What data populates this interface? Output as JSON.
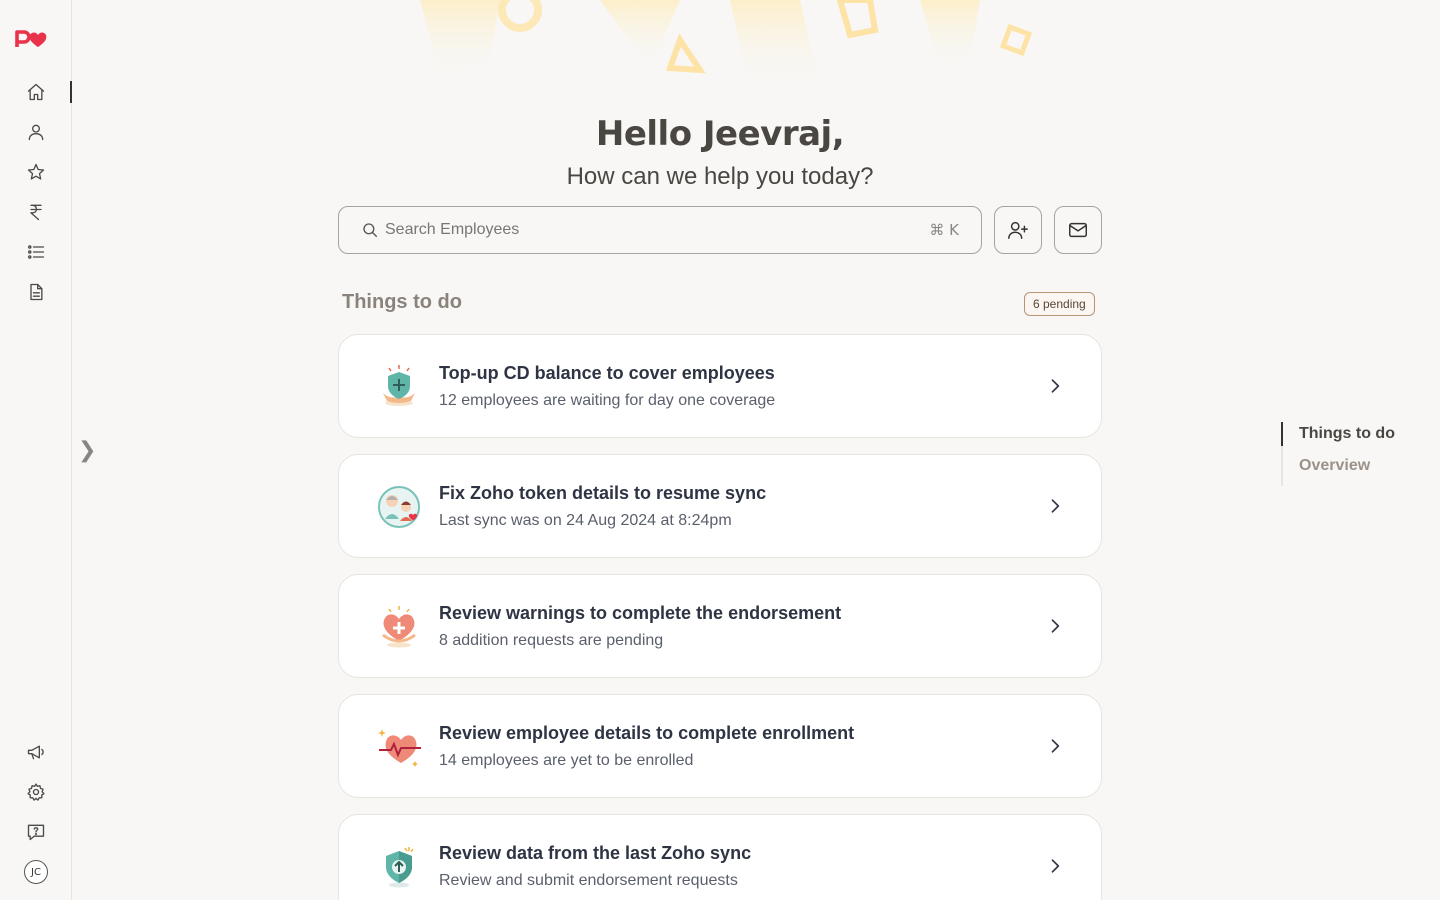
{
  "brand": {
    "logo_text": "pv",
    "accent": "#e8334a"
  },
  "sidebar": {
    "top_items": [
      {
        "name": "home",
        "icon": "home-icon",
        "active": true
      },
      {
        "name": "people",
        "icon": "user-icon"
      },
      {
        "name": "benefits",
        "icon": "star-icon"
      },
      {
        "name": "payments",
        "icon": "rupee-icon"
      },
      {
        "name": "tasks",
        "icon": "list-icon"
      },
      {
        "name": "documents",
        "icon": "document-icon"
      }
    ],
    "bottom_items": [
      {
        "name": "announcements",
        "icon": "megaphone-icon"
      },
      {
        "name": "settings",
        "icon": "gear-icon"
      },
      {
        "name": "help",
        "icon": "help-chat-icon"
      }
    ],
    "avatar_initials": "JC",
    "expand_glyph": "❯"
  },
  "header": {
    "greeting": "Hello Jeevraj,",
    "subtitle": "How can we help you today?"
  },
  "search": {
    "placeholder": "Search Employees",
    "shortcut": "⌘ K"
  },
  "actions": [
    {
      "name": "add-employee",
      "icon": "user-plus-icon"
    },
    {
      "name": "mail",
      "icon": "mail-icon"
    }
  ],
  "things_to_do": {
    "title": "Things to do",
    "pending_badge": "6 pending",
    "items": [
      {
        "title": "Top-up CD balance to cover employees",
        "description": "12 employees are waiting for day one coverage",
        "icon": "shield-plus-illustration"
      },
      {
        "title": "Fix Zoho token details to resume sync",
        "description": "Last sync was on 24 Aug 2024 at 8:24pm",
        "icon": "family-illustration"
      },
      {
        "title": "Review warnings to complete the endorsement",
        "description": "8 addition requests are pending",
        "icon": "heart-plus-illustration"
      },
      {
        "title": "Review employee details to complete enrollment",
        "description": "14 employees are yet to be enrolled",
        "icon": "heartbeat-illustration"
      },
      {
        "title": "Review data from the last Zoho sync",
        "description": "Review and submit endorsement requests",
        "icon": "shield-upload-illustration"
      }
    ]
  },
  "toc": {
    "items": [
      {
        "label": "Things to do",
        "active": true
      },
      {
        "label": "Overview",
        "active": false
      }
    ]
  }
}
